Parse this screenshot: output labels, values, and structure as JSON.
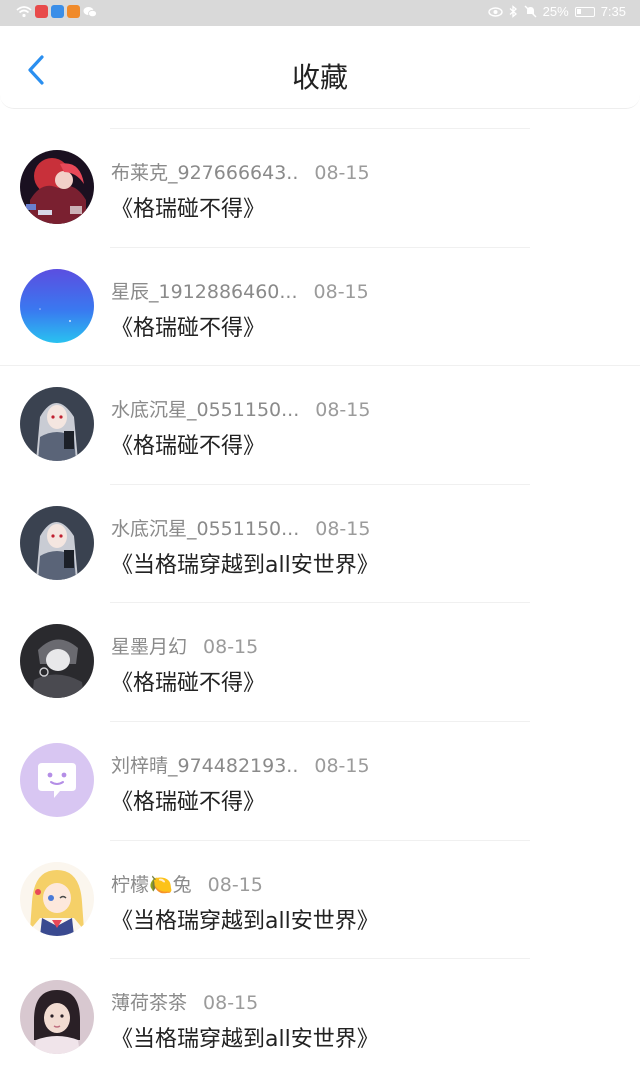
{
  "status_bar": {
    "battery_percent": "25%",
    "time": "7:35",
    "icons": [
      "wifi-icon",
      "app-icon-red",
      "app-icon-blue",
      "app-icon-orange",
      "wechat-icon",
      "eye-icon",
      "bluetooth-icon",
      "mute-icon",
      "battery-icon"
    ]
  },
  "header": {
    "title": "收藏",
    "back_icon": "chevron-left-icon"
  },
  "colors": {
    "accent": "#2a8ff0",
    "status_bar_bg": "#d9d9d9",
    "meta_text": "#8a8a8a",
    "title_text": "#222222"
  },
  "items": [
    {
      "user": "布莱克_927666643..",
      "date": "08-15",
      "title": "《格瑞碰不得》",
      "avatar": "anime-red-hair-avatar"
    },
    {
      "user": "星辰_1912886460...",
      "date": "08-15",
      "title": "《格瑞碰不得》",
      "avatar": "blue-gradient-avatar"
    },
    {
      "user": "水底沉星_0551150...",
      "date": "08-15",
      "title": "《格瑞碰不得》",
      "avatar": "anime-grey-hair-avatar"
    },
    {
      "user": "水底沉星_0551150...",
      "date": "08-15",
      "title": "《当格瑞穿越到all安世界》",
      "avatar": "anime-grey-hair-avatar"
    },
    {
      "user": "星墨月幻",
      "date": "08-15",
      "title": "《格瑞碰不得》",
      "avatar": "anime-monochrome-avatar"
    },
    {
      "user": "刘梓晴_974482193..",
      "date": "08-15",
      "title": "《格瑞碰不得》",
      "avatar": "default-chat-bubble-avatar"
    },
    {
      "user": "柠檬🍋兔",
      "date": "08-15",
      "title": "《当格瑞穿越到all安世界》",
      "avatar": "anime-blonde-girl-avatar"
    },
    {
      "user": "薄荷茶茶",
      "date": "08-15",
      "title": "《当格瑞穿越到all安世界》",
      "avatar": "photo-girl-avatar"
    }
  ]
}
